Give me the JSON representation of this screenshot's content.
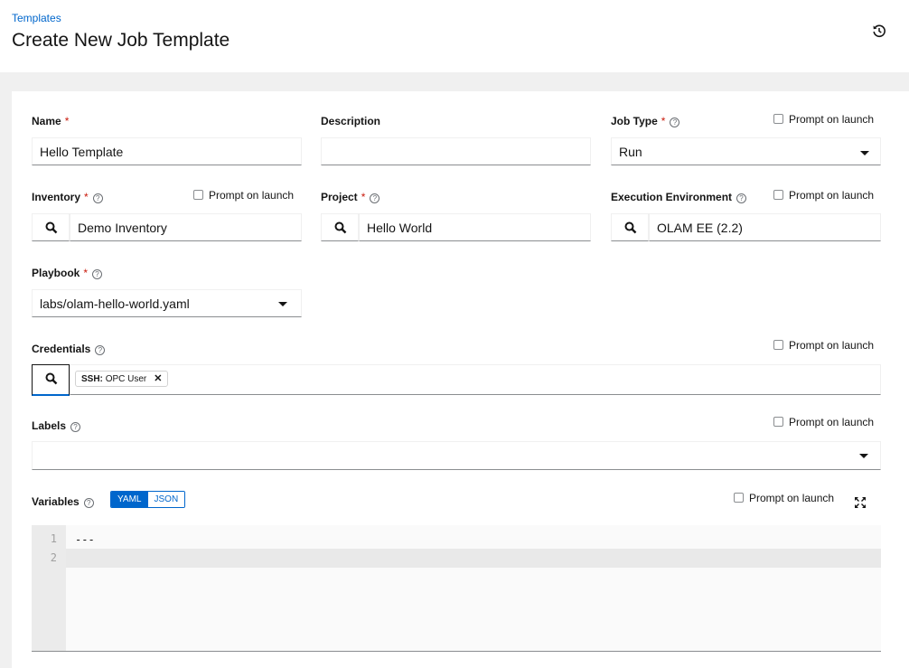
{
  "header": {
    "breadcrumb": "Templates",
    "title": "Create New Job Template"
  },
  "form": {
    "name": {
      "label": "Name",
      "required": "*",
      "value": "Hello Template"
    },
    "description": {
      "label": "Description",
      "value": ""
    },
    "job_type": {
      "label": "Job Type",
      "required": "*",
      "value": "Run",
      "prompt": "Prompt on launch"
    },
    "inventory": {
      "label": "Inventory",
      "required": "*",
      "value": "Demo Inventory",
      "prompt": "Prompt on launch"
    },
    "project": {
      "label": "Project",
      "required": "*",
      "value": "Hello World"
    },
    "execution_environment": {
      "label": "Execution Environment",
      "value": "OLAM EE (2.2)",
      "prompt": "Prompt on launch"
    },
    "playbook": {
      "label": "Playbook",
      "required": "*",
      "value": "labs/olam-hello-world.yaml"
    },
    "credentials": {
      "label": "Credentials",
      "prompt": "Prompt on launch",
      "chips": [
        {
          "type": "SSH:",
          "name": "OPC User"
        }
      ]
    },
    "labels": {
      "label": "Labels",
      "prompt": "Prompt on launch"
    },
    "variables": {
      "label": "Variables",
      "modes": [
        "YAML",
        "JSON"
      ],
      "selected_mode": "YAML",
      "prompt": "Prompt on launch",
      "lines": [
        "---",
        ""
      ],
      "line_numbers": [
        "1",
        "2"
      ]
    }
  },
  "colors": {
    "accent": "#0066cc",
    "required": "#c9190b",
    "page_bg": "#f0f0f0"
  },
  "icons": [
    "history-icon",
    "search-icon",
    "caret-down-icon",
    "help-icon",
    "close-icon",
    "expand-icon",
    "checkbox-icon"
  ]
}
